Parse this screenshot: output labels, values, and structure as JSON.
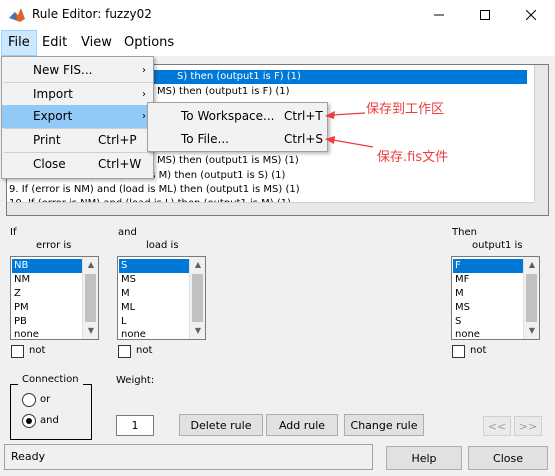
{
  "window": {
    "title": "Rule Editor: fuzzy02"
  },
  "menubar": {
    "file": "File",
    "edit": "Edit",
    "view": "View",
    "options": "Options"
  },
  "file_menu": {
    "items": [
      {
        "label": "New FIS...",
        "shortcut": "",
        "submenu": true
      },
      {
        "label": "Import",
        "shortcut": "",
        "submenu": true
      },
      {
        "label": "Export",
        "shortcut": "",
        "submenu": true
      },
      {
        "label": "Print",
        "shortcut": "Ctrl+P"
      },
      {
        "label": "Close",
        "shortcut": "Ctrl+W"
      }
    ]
  },
  "export_menu": {
    "items": [
      {
        "label": "To Workspace...",
        "shortcut": "Ctrl+T"
      },
      {
        "label": "To File...",
        "shortcut": "Ctrl+S"
      }
    ]
  },
  "annotations": {
    "workspace": "保存到工作区",
    "file": "保存.fis文件"
  },
  "rules": {
    "visible_lines": [
      "S) then (output1 is F) (1)",
      "MS) then (output1 is F) (1)",
      "MS) then (output1 is MS) (1)",
      "9. If (error is NM) and (load is M) then (output1 is S) (1)",
      "9. If (error is NM) and (load is ML) then (output1 is MS) (1)",
      "10. If (error is NM) and (load is L) then (output1 is M) (1)"
    ]
  },
  "if_section": {
    "label": "If",
    "var_label": "error is",
    "options": [
      "NB",
      "NM",
      "Z",
      "PM",
      "PB",
      "none"
    ],
    "not_label": "not"
  },
  "and_section": {
    "label": "and",
    "var_label": "load is",
    "options": [
      "S",
      "MS",
      "M",
      "ML",
      "L",
      "none"
    ],
    "not_label": "not"
  },
  "then_section": {
    "label": "Then",
    "var_label": "output1 is",
    "options": [
      "F",
      "MF",
      "M",
      "MS",
      "S",
      "none"
    ],
    "not_label": "not"
  },
  "connection": {
    "title": "Connection",
    "or_label": "or",
    "and_label": "and",
    "selected": "and"
  },
  "weight": {
    "label": "Weight:",
    "value": "1"
  },
  "buttons": {
    "delete_rule": "Delete rule",
    "add_rule": "Add rule",
    "change_rule": "Change rule",
    "prev": "<<",
    "next": ">>",
    "help": "Help",
    "close": "Close"
  },
  "status": {
    "text": "Ready"
  },
  "colors": {
    "selection": "#0078d7",
    "menu_highlight": "#91c9f7",
    "annotation": "#ee3b3b"
  }
}
